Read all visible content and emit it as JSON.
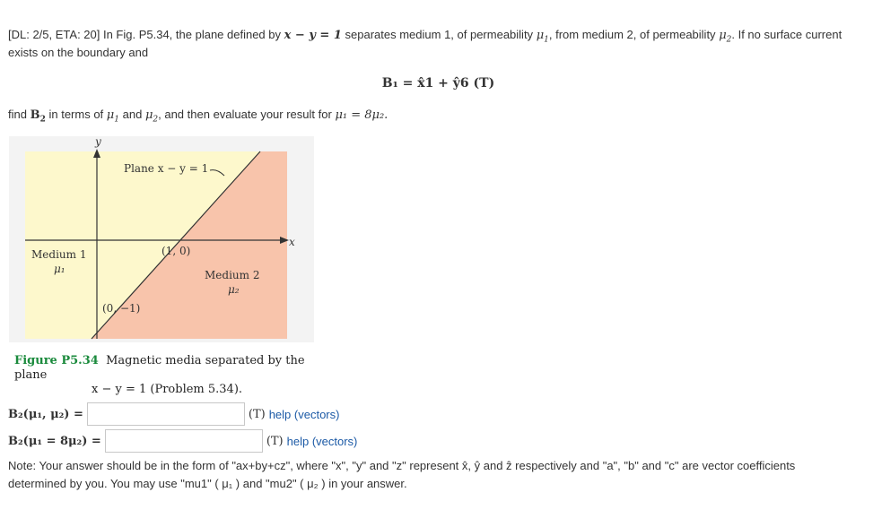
{
  "problem": {
    "prefix": "[DL: 2/5, ETA: 20] In Fig. P5.34, the plane defined by",
    "plane_eq": "x − y = 1",
    "mid1": "separates medium 1, of permeability",
    "mu1": "μ",
    "mid2": ", from medium 2, of permeability",
    "end1": ". If no surface current",
    "line2": "exists on the boundary and",
    "given_eq": "B₁ = x̂1 + ŷ6  (T)",
    "find_pre": "find",
    "find_B2": "B",
    "find_mid": "in terms of",
    "find_and": "and",
    "find_post": ", and then evaluate your result for",
    "find_cond": "μ₁ = 8μ₂."
  },
  "figure": {
    "label_y": "y",
    "label_x": "x",
    "plane_label": "Plane x − y = 1",
    "medium1": "Medium 1",
    "medium1_mu": "μ₁",
    "medium2": "Medium 2",
    "medium2_mu": "μ₂",
    "point_a": "(1, 0)",
    "point_b": "(0, −1)",
    "caption_num": "Figure P5.34",
    "caption_l1": "Magnetic media separated by the plane",
    "caption_l2": "x − y = 1 (Problem 5.34).",
    "colors": {
      "medium1": "#fdf8cc",
      "medium2": "#f8c4ab",
      "panel": "#f3f3f3"
    }
  },
  "answers": [
    {
      "label": "B₂(μ₁, μ₂) =",
      "value": "",
      "unit": "(T)",
      "help": "help (vectors)"
    },
    {
      "label": "B₂(μ₁ = 8μ₂) =",
      "value": "",
      "unit": "(T)",
      "help": "help (vectors)"
    }
  ],
  "note": {
    "line1": "Note: Your answer should be in the form of \"ax+by+cz\", where \"x\", \"y\" and \"z\" represent x̂, ŷ and ẑ respectively and \"a\", \"b\" and \"c\" are vector coefficients",
    "line2": "determined by you. You may use \"mu1\" ( μ₁ ) and \"mu2\" ( μ₂ ) in your answer."
  }
}
